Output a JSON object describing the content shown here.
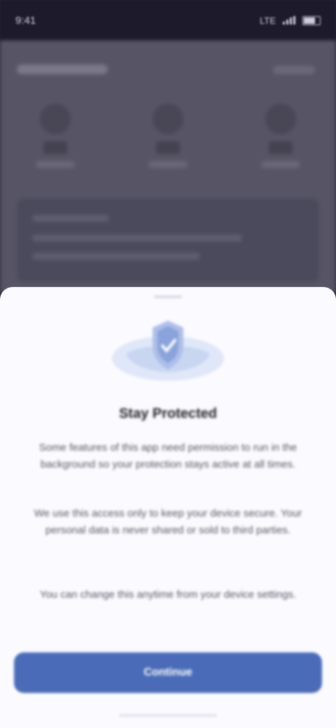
{
  "status_bar": {
    "time": "9:41",
    "network": "LTE",
    "icons": [
      "signal-icon",
      "battery-icon"
    ]
  },
  "background_app": {
    "obscured": true
  },
  "sheet": {
    "title": "Stay Protected",
    "paragraphs": [
      "Some features of this app need permission to run in the background so your protection stays active at all times.",
      "We use this access only to keep your device secure. Your personal data is never shared or sold to third parties.",
      "You can change this anytime from your device settings."
    ],
    "cta_label": "Continue",
    "hero_icon": "shield-illustration-icon",
    "colors": {
      "accent": "#4a6cb8",
      "sheet_background": "#fbfbff",
      "status_bar": "#1c1a2b"
    }
  }
}
